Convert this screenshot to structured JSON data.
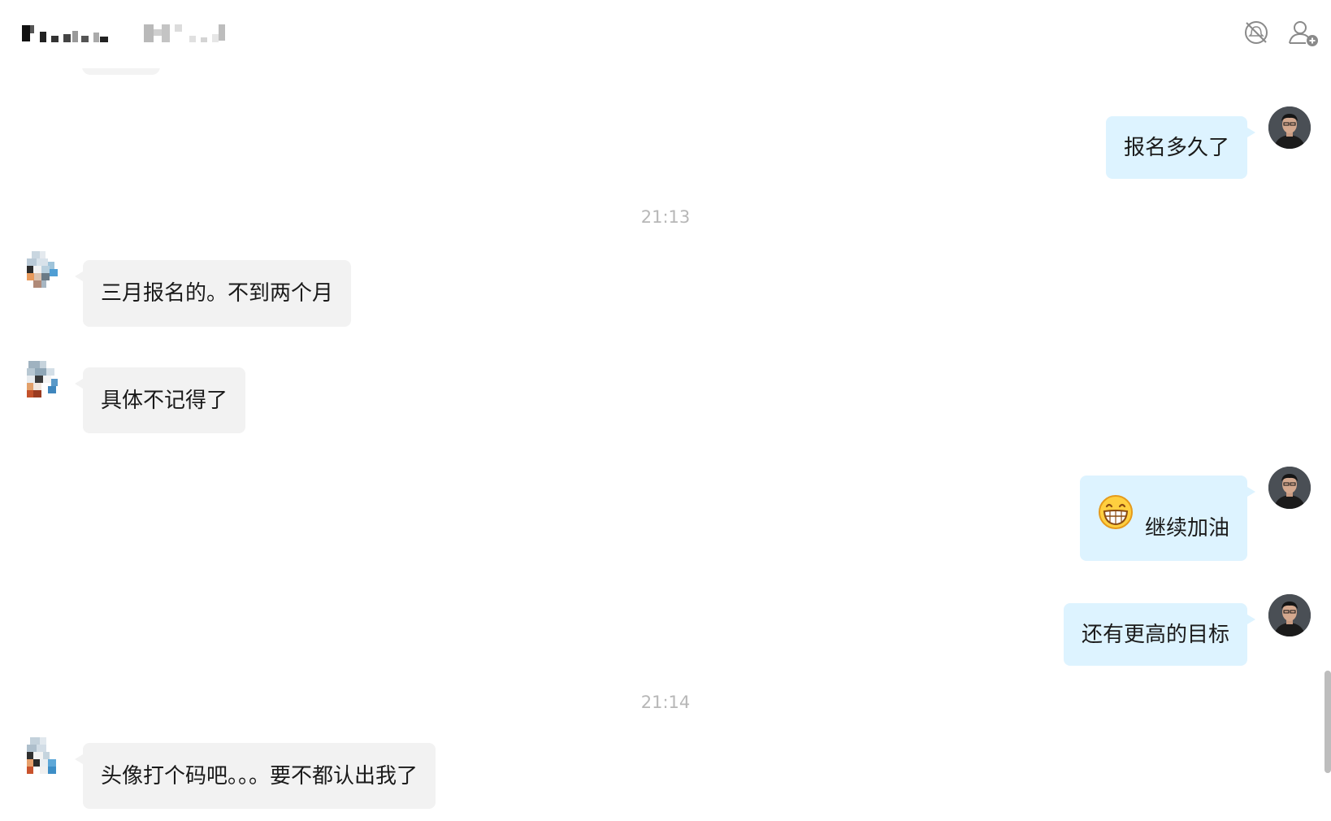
{
  "header": {
    "title": "",
    "icons": {
      "mute": "bell-off-icon",
      "add_member": "add-user-icon"
    }
  },
  "messages": [
    {
      "id": "m1",
      "direction": "out",
      "text": "报名多久了"
    },
    {
      "id": "t1",
      "type": "time",
      "text": "21:13"
    },
    {
      "id": "m2",
      "direction": "in",
      "text": "三月报名的。不到两个月"
    },
    {
      "id": "m3",
      "direction": "in",
      "text": "具体不记得了"
    },
    {
      "id": "m4",
      "direction": "out",
      "emoji": "grinning-face-emoji",
      "text": "继续加油"
    },
    {
      "id": "m5",
      "direction": "out",
      "text": "还有更高的目标"
    },
    {
      "id": "t2",
      "type": "time",
      "text": "21:14"
    },
    {
      "id": "m6",
      "direction": "in",
      "text": "头像打个码吧。。。要不都认出我了"
    }
  ],
  "colors": {
    "incoming_bubble": "#f2f2f2",
    "outgoing_bubble": "#ddf3ff",
    "timestamp": "#b7b7b7",
    "background": "#ffffff"
  }
}
